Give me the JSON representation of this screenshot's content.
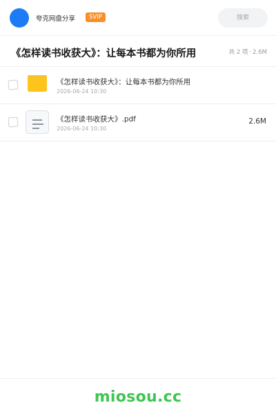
{
  "header": {
    "brand": "夸克网盘分享",
    "badge": "SVIP",
    "search_placeholder": "搜索"
  },
  "folder": {
    "title": "《怎样读书收获大》：让每本书都为你所用",
    "meta_count": "共 2 项",
    "meta_separator": "·",
    "meta_size": "2.6M"
  },
  "files": [
    {
      "icon": "folder-icon",
      "name": "《怎样读书收获大》：让每本书都为你所用",
      "date": "2026-06-24 10:30",
      "size": ""
    },
    {
      "icon": "document-icon",
      "name": "《怎样读书收获大》.pdf",
      "date": "2026-06-24 10:30",
      "size": "2.6M"
    }
  ],
  "footer": {
    "logo": "miosou.cc"
  },
  "colors": {
    "avatar": "#1c7bf5",
    "badge": "#f7902b",
    "folder": "#ffc41a",
    "footer_logo": "#3ec552"
  }
}
